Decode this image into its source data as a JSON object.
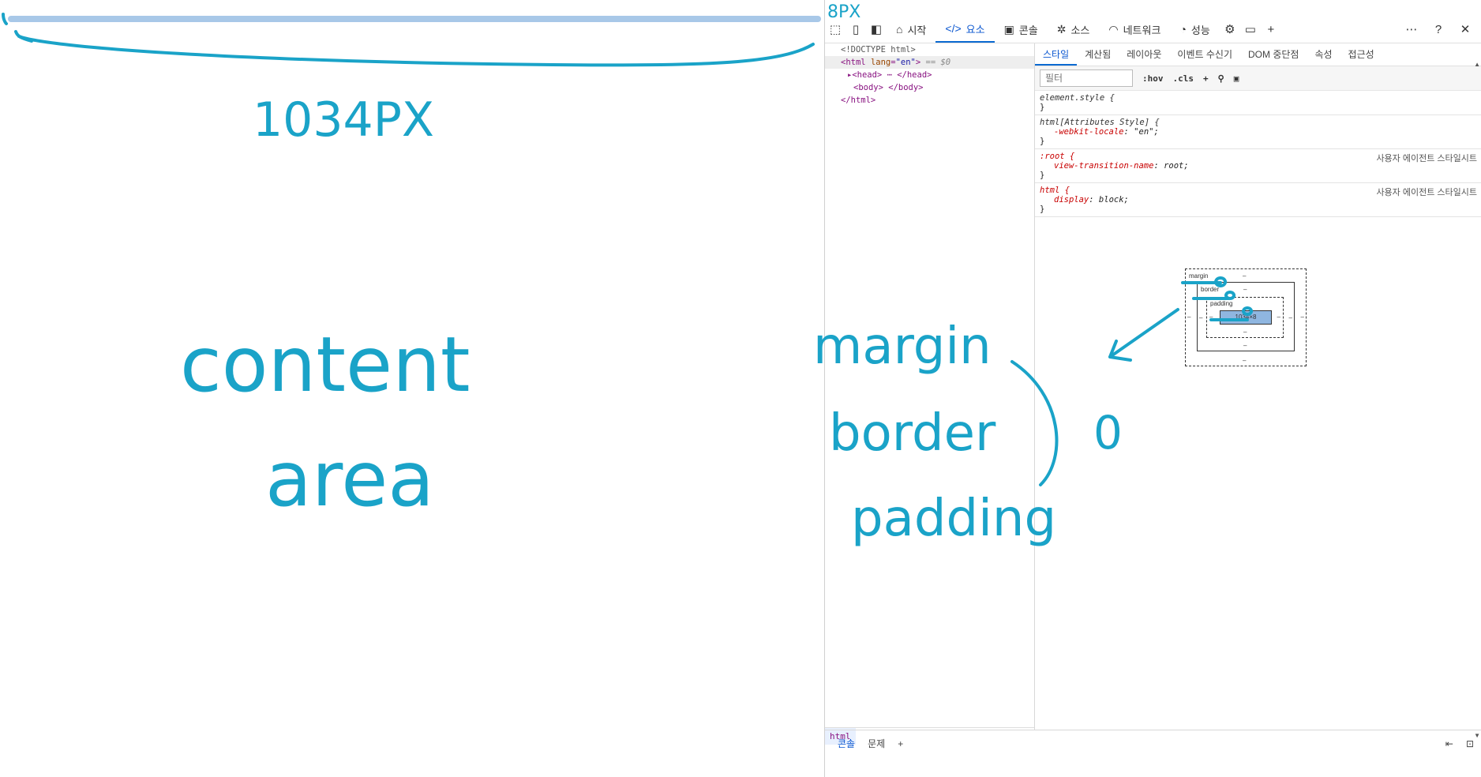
{
  "devtools": {
    "toolbar": {
      "tabs": [
        {
          "label": "시작",
          "icon": "home-icon"
        },
        {
          "label": "요소",
          "icon": "code-icon"
        },
        {
          "label": "콘솔",
          "icon": "console-icon"
        },
        {
          "label": "소스",
          "icon": "bug-icon"
        },
        {
          "label": "네트워크",
          "icon": "wifi-icon"
        },
        {
          "label": "성능",
          "icon": "gauge-icon"
        }
      ],
      "active_tab": "요소"
    },
    "dom": {
      "doctype": "<!DOCTYPE html>",
      "html_open": "<html",
      "html_attr": "lang",
      "html_val": "\"en\"",
      "html_close": ">",
      "html_marker": "== $0",
      "head": "<head> ⋯ </head>",
      "body": "<body> </body>",
      "html_end": "</html>",
      "breadcrumb": "html"
    },
    "styles": {
      "subtabs": [
        "스타일",
        "계산됨",
        "레이아웃",
        "이벤트 수신기",
        "DOM 중단점",
        "속성",
        "접근성"
      ],
      "filter_placeholder": "필터",
      "hov": ":hov",
      "cls": ".cls",
      "rules": [
        {
          "selector": "element.style {",
          "decls": [],
          "source": ""
        },
        {
          "selector": "html[Attributes Style] {",
          "decls": [
            {
              "prop": "-webkit-locale",
              "val": "\"en\";"
            }
          ],
          "source": ""
        },
        {
          "selector": ":root {",
          "decls": [
            {
              "prop": "view-transition-name",
              "val": "root;"
            }
          ],
          "source": "사용자 에이전트 스타일시트"
        },
        {
          "selector": "html {",
          "decls": [
            {
              "prop": "display",
              "val": "block;"
            }
          ],
          "source": "사용자 에이전트 스타일시트"
        }
      ],
      "close_brace": "}"
    },
    "box_model": {
      "margin_label": "margin",
      "border_label": "border",
      "padding_label": "padding",
      "dash": "–",
      "content": "1034×8"
    },
    "bottom": {
      "tabs": [
        "콘솔",
        "문제"
      ]
    }
  },
  "annotations": {
    "width_note": "1034PX",
    "margin_note": "8PX",
    "content_note_1": "content",
    "content_note_2": "area",
    "list": [
      "margin",
      "border",
      "padding"
    ],
    "zero": "0"
  }
}
